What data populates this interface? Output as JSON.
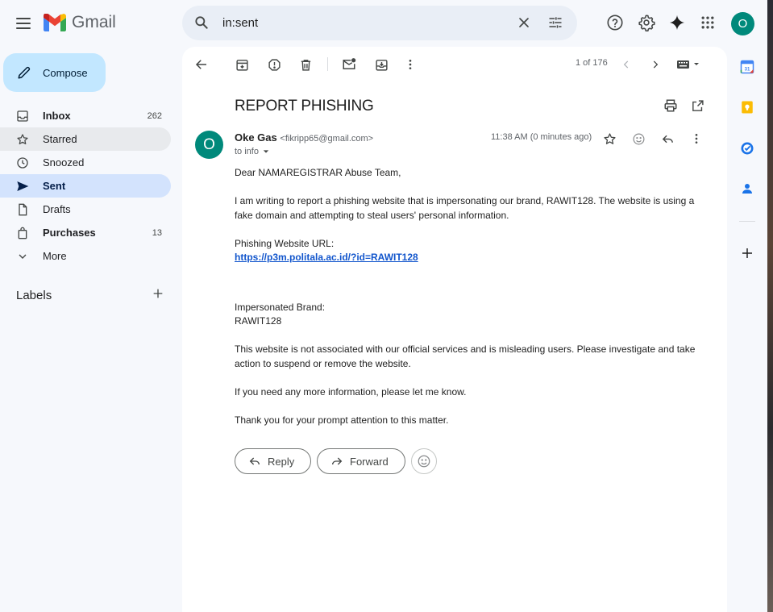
{
  "app": {
    "name": "Gmail"
  },
  "search": {
    "value": "in:sent"
  },
  "user": {
    "initial": "O"
  },
  "compose": {
    "label": "Compose"
  },
  "nav": [
    {
      "key": "inbox",
      "label": "Inbox",
      "count": "262",
      "icon": "inbox-icon"
    },
    {
      "key": "starred",
      "label": "Starred",
      "count": "",
      "icon": "star-icon"
    },
    {
      "key": "snoozed",
      "label": "Snoozed",
      "count": "",
      "icon": "clock-icon"
    },
    {
      "key": "sent",
      "label": "Sent",
      "count": "",
      "icon": "send-icon"
    },
    {
      "key": "drafts",
      "label": "Drafts",
      "count": "",
      "icon": "draft-icon"
    },
    {
      "key": "purchases",
      "label": "Purchases",
      "count": "13",
      "icon": "shopping-bag-icon"
    },
    {
      "key": "more",
      "label": "More",
      "count": "",
      "icon": "chevron-down-icon"
    }
  ],
  "labels": {
    "title": "Labels"
  },
  "toolbar": {
    "pager": "1 of 176"
  },
  "email": {
    "subject": "REPORT PHISHING",
    "sender_name": "Oke Gas",
    "sender_email": "<fikripp65@gmail.com>",
    "sender_initial": "O",
    "recipients": "to info",
    "time": "11:38 AM (0 minutes ago)",
    "greeting": "Dear NAMAREGISTRAR Abuse Team,",
    "para1": "I am writing to report a phishing website that is impersonating our brand, RAWIT128. The website is using a fake domain and attempting to steal users' personal information.",
    "url_label": "Phishing Website URL:",
    "url": "https://p3m.politala.ac.id/?id=RAWIT128",
    "brand_label": "Impersonated Brand:",
    "brand": "RAWIT128",
    "para2": "This website is not associated with our official services and is misleading users. Please investigate and take action to suspend or remove the website.",
    "para3": "If you need any more information, please let me know.",
    "para4": "Thank you for your prompt attention to this matter."
  },
  "actions": {
    "reply": "Reply",
    "forward": "Forward"
  },
  "colors": {
    "accent": "#c2e7ff",
    "active_nav": "#d3e3fd",
    "avatar": "#00897b",
    "link": "#1155cc"
  }
}
